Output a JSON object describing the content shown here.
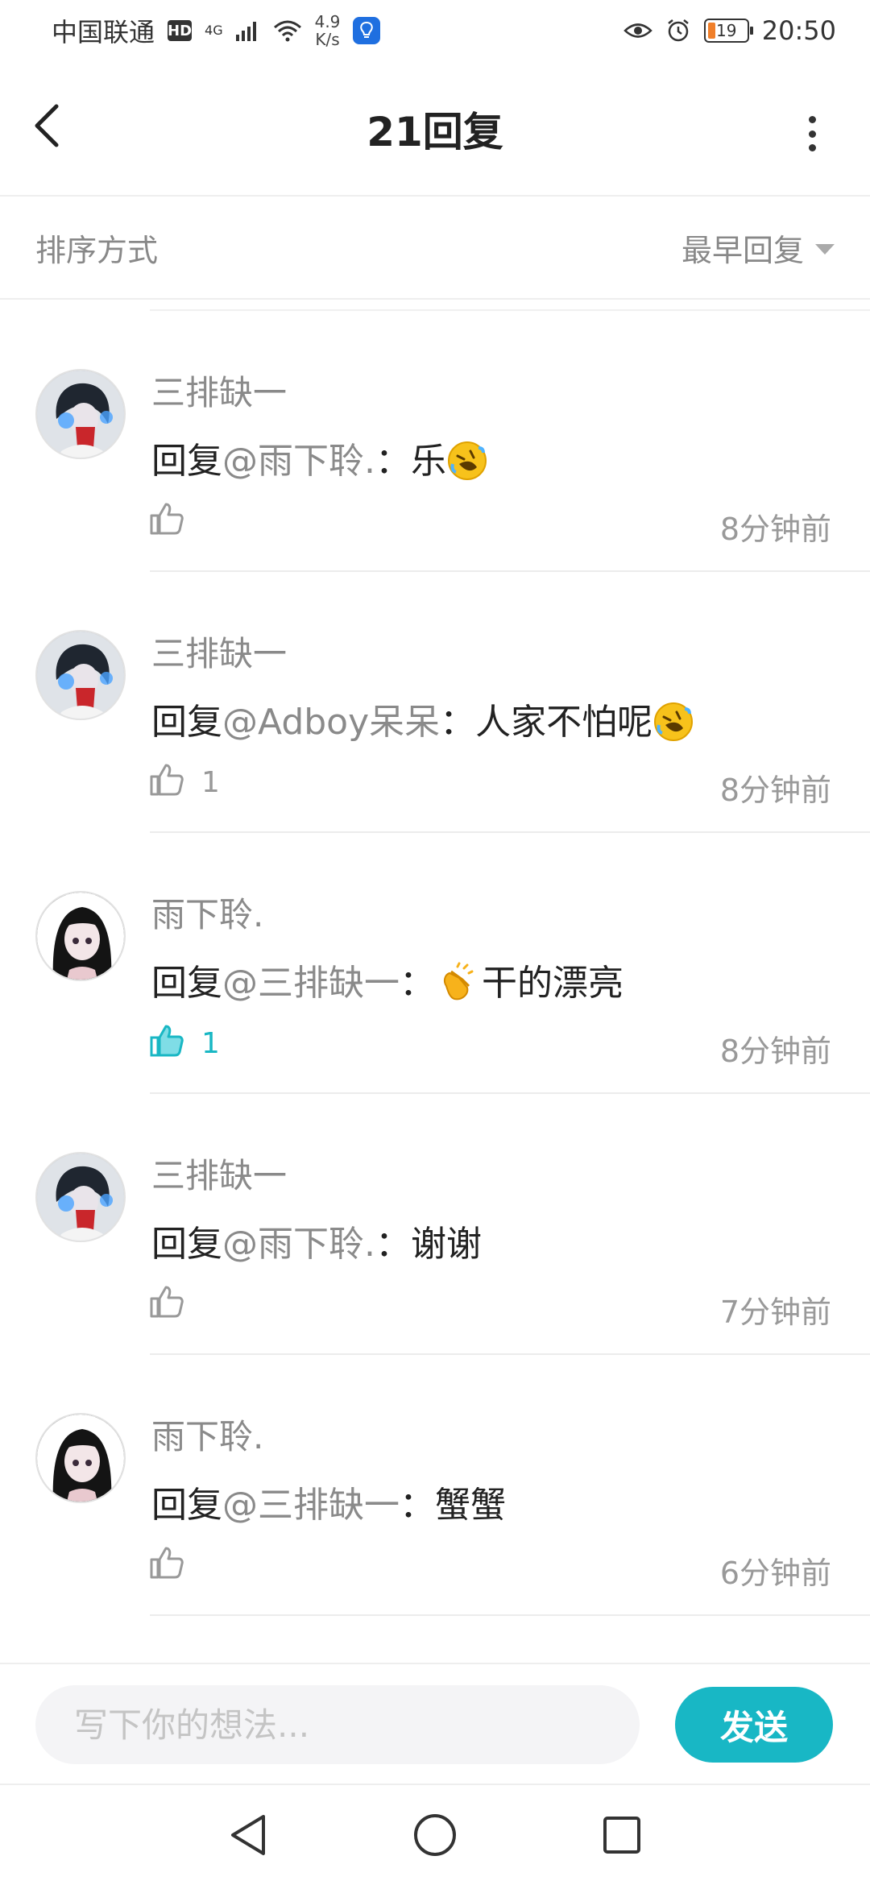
{
  "status_bar": {
    "carrier": "中国联通",
    "hd_badge": "HD",
    "network": "4G",
    "speed_value": "4.9",
    "speed_unit": "K/s",
    "battery": "19",
    "time": "20:50"
  },
  "header": {
    "title": "21回复"
  },
  "sort": {
    "label": "排序方式",
    "selected": "最早回复"
  },
  "comments": [
    {
      "username": "三排缺一",
      "reply_prefix": "回复",
      "mention": "@雨下聆.",
      "separator": "：",
      "text": "乐",
      "emoji": "rolling-on-floor-laughing",
      "likes": "",
      "liked": false,
      "time": "8分钟前"
    },
    {
      "username": "三排缺一",
      "reply_prefix": "回复",
      "mention": "@Adboy呆呆",
      "separator": "：",
      "text": "人家不怕呢",
      "emoji": "rolling-on-floor-laughing",
      "likes": "1",
      "liked": false,
      "time": "8分钟前"
    },
    {
      "username": "雨下聆.",
      "reply_prefix": "回复",
      "mention": "@三排缺一",
      "separator": "：",
      "text": "干的漂亮",
      "emoji": "clapping-hands",
      "likes": "1",
      "liked": true,
      "time": "8分钟前"
    },
    {
      "username": "三排缺一",
      "reply_prefix": "回复",
      "mention": "@雨下聆.",
      "separator": "：",
      "text": "谢谢",
      "emoji": "",
      "likes": "",
      "liked": false,
      "time": "7分钟前"
    },
    {
      "username": "雨下聆.",
      "reply_prefix": "回复",
      "mention": "@三排缺一",
      "separator": "：",
      "text": "蟹蟹",
      "emoji": "",
      "likes": "",
      "liked": false,
      "time": "6分钟前"
    }
  ],
  "input": {
    "placeholder": "写下你的想法...",
    "send_label": "发送"
  },
  "colors": {
    "accent": "#18b7c5",
    "liked": "#19b7c4",
    "muted_text": "#8a8a8a",
    "body_text": "#222222"
  },
  "icons": {
    "back": "chevron-left-icon",
    "more": "more-vertical-icon",
    "like": "thumbs-up-icon",
    "sort_caret": "caret-down-icon",
    "nav": [
      "back-triangle-icon",
      "home-circle-icon",
      "recents-square-icon"
    ]
  }
}
